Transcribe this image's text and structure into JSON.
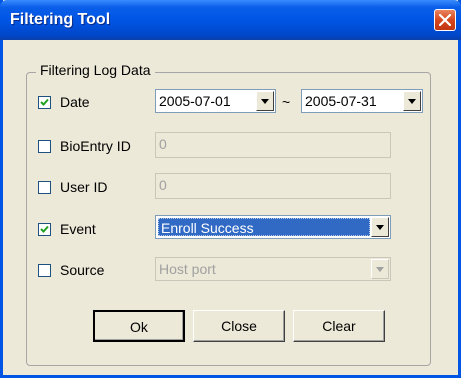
{
  "window": {
    "title": "Filtering Tool"
  },
  "group": {
    "legend": "Filtering Log Data"
  },
  "date": {
    "label": "Date",
    "checked": true,
    "from": "2005-07-01",
    "separator": "~",
    "to": "2005-07-31"
  },
  "bioentry": {
    "label": "BioEntry ID",
    "checked": false,
    "value": "0"
  },
  "userid": {
    "label": "User ID",
    "checked": false,
    "value": "0"
  },
  "event": {
    "label": "Event",
    "checked": true,
    "value": "Enroll Success"
  },
  "source": {
    "label": "Source",
    "checked": false,
    "value": "Host port"
  },
  "buttons": {
    "ok": "Ok",
    "close": "Close",
    "clear": "Clear"
  },
  "colors": {
    "titlebar": "#0055e5",
    "dialog_bg": "#ece9d8",
    "selection": "#316ac5"
  }
}
